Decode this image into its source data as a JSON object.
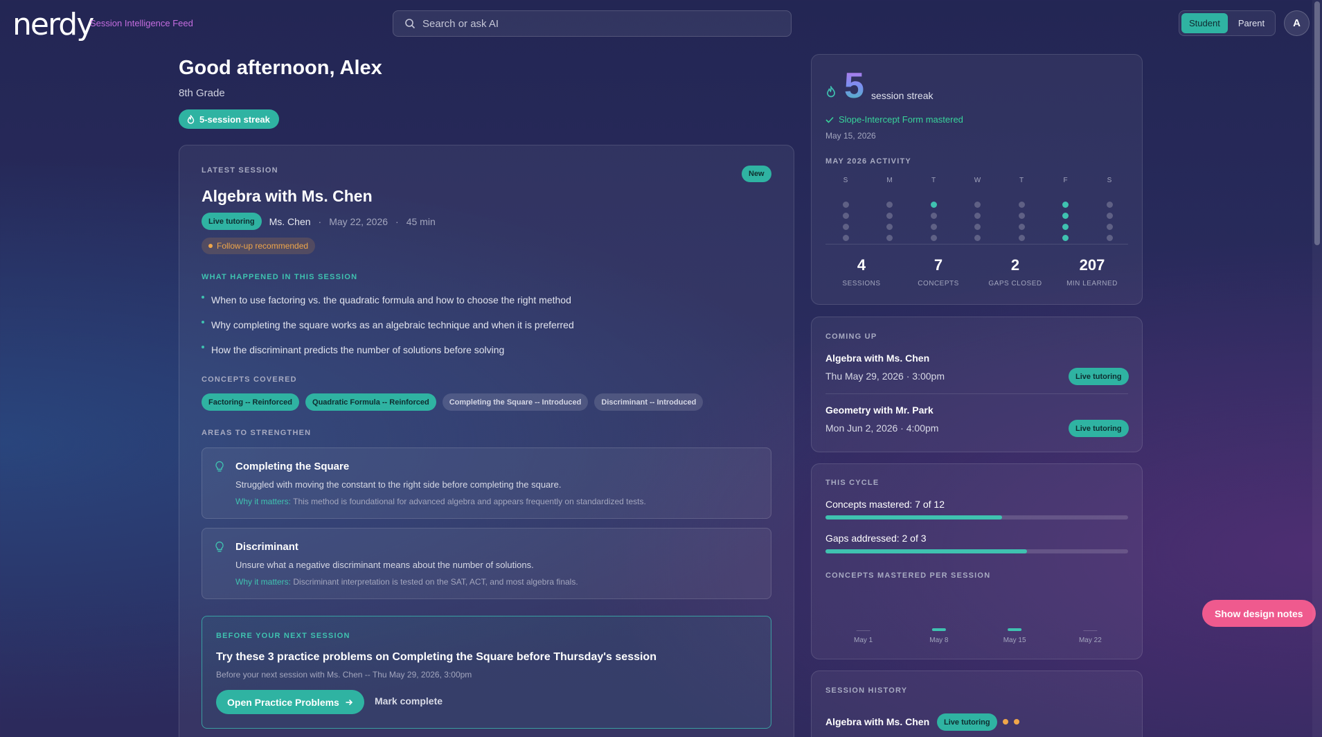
{
  "header": {
    "logo": "nerdy",
    "subtitle": "Session Intelligence Feed",
    "search_placeholder": "Search or ask AI",
    "toggle": [
      "Student",
      "Parent"
    ],
    "avatar": "A"
  },
  "greeting": {
    "title": "Good afternoon, Alex",
    "grade": "8th Grade",
    "streak_pill": "5-session streak"
  },
  "latest": {
    "label": "LATEST SESSION",
    "badge": "New",
    "title": "Algebra with Ms. Chen",
    "type_tag": "Live tutoring",
    "tutor": "Ms. Chen",
    "date": "May 22, 2026",
    "duration": "45 min",
    "sep": "·",
    "followup": "Follow-up recommended",
    "happened_label": "WHAT HAPPENED IN THIS SESSION",
    "happened": [
      "When to use factoring vs. the quadratic formula and how to choose the right method",
      "Why completing the square works as an algebraic technique and when it is preferred",
      "How the discriminant predicts the number of solutions before solving"
    ],
    "concepts_label": "CONCEPTS COVERED",
    "concepts": [
      {
        "text": "Factoring -- Reinforced",
        "style": "teal"
      },
      {
        "text": "Quadratic Formula -- Reinforced",
        "style": "teal"
      },
      {
        "text": "Completing the Square -- Introduced",
        "style": "grey"
      },
      {
        "text": "Discriminant -- Introduced",
        "style": "grey"
      }
    ],
    "areas_label": "AREAS TO STRENGTHEN",
    "areas": [
      {
        "title": "Completing the Square",
        "desc": "Struggled with moving the constant to the right side before completing the square.",
        "why_key": "Why it matters:",
        "why": "This method is foundational for advanced algebra and appears frequently on standardized tests."
      },
      {
        "title": "Discriminant",
        "desc": "Unsure what a negative discriminant means about the number of solutions.",
        "why_key": "Why it matters:",
        "why": "Discriminant interpretation is tested on the SAT, ACT, and most algebra finals."
      }
    ],
    "prep": {
      "label": "BEFORE YOUR NEXT SESSION",
      "title": "Try these 3 practice problems on Completing the Square before Thursday's session",
      "sub": "Before your next session with Ms. Chen -- Thu May 29, 2026, 3:00pm",
      "primary_btn": "Open Practice Problems",
      "secondary_btn": "Mark complete"
    }
  },
  "streak": {
    "count": "5",
    "label": "session streak",
    "mastered": "Slope-Intercept Form mastered",
    "mastered_date": "May 15, 2026",
    "activity_label": "MAY 2026 ACTIVITY",
    "days": [
      "S",
      "M",
      "T",
      "W",
      "T",
      "F",
      "S"
    ],
    "activity": [
      [
        false,
        false,
        false,
        false
      ],
      [
        false,
        false,
        false,
        false
      ],
      [
        true,
        false,
        false,
        false
      ],
      [
        false,
        false,
        false,
        false
      ],
      [
        false,
        false,
        false,
        false
      ],
      [
        true,
        true,
        true,
        true
      ],
      [
        false,
        false,
        false,
        false
      ]
    ],
    "stats": [
      {
        "n": "4",
        "l": "SESSIONS"
      },
      {
        "n": "7",
        "l": "CONCEPTS"
      },
      {
        "n": "2",
        "l": "GAPS CLOSED"
      },
      {
        "n": "207",
        "l": "MIN LEARNED"
      }
    ]
  },
  "coming_up": {
    "label": "COMING UP",
    "items": [
      {
        "title": "Algebra with Ms. Chen",
        "date": "Thu May 29, 2026 · 3:00pm",
        "tag": "Live tutoring"
      },
      {
        "title": "Geometry with Mr. Park",
        "date": "Mon Jun 2, 2026 · 4:00pm",
        "tag": "Live tutoring"
      }
    ]
  },
  "cycle": {
    "label": "THIS CYCLE",
    "concepts_text": "Concepts mastered: 7 of 12",
    "concepts_progress": 0.583,
    "gaps_text": "Gaps addressed: 2 of 3",
    "gaps_progress": 0.667,
    "chart_label": "CONCEPTS MASTERED PER SESSION"
  },
  "chart_data": {
    "type": "bar",
    "categories": [
      "May 1",
      "May 8",
      "May 15",
      "May 22"
    ],
    "values": [
      0,
      1,
      1,
      0
    ],
    "ylim": [
      0,
      10
    ],
    "title": "CONCEPTS MASTERED PER SESSION",
    "xlabel": "",
    "ylabel": "",
    "grid": false
  },
  "design_notes_btn": "Show design notes",
  "history": {
    "label": "SESSION HISTORY",
    "title": "Algebra with Ms. Chen",
    "tag": "Live tutoring"
  },
  "colors": {
    "accent": "#2fb3a2",
    "warning": "#f0a64a",
    "success": "#38d39a",
    "pink": "#ef5a8e",
    "purple": "#c56de0"
  }
}
